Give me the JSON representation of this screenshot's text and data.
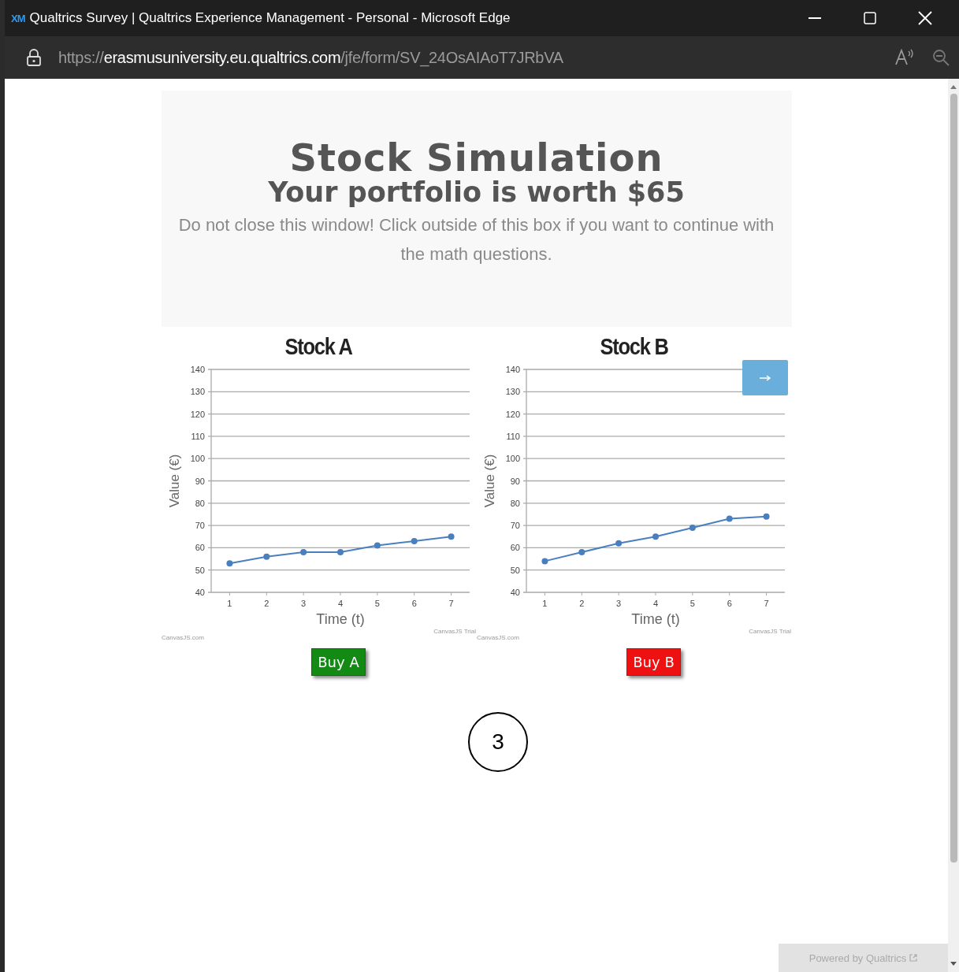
{
  "window": {
    "logo": "XM",
    "title": "Qualtrics Survey | Qualtrics Experience Management - Personal - Microsoft Edge"
  },
  "address_bar": {
    "url": "https://**erasmusuniversity.eu.qualtrics.com**/jfe/form/SV_24OsAIAoT7JRbVA"
  },
  "header": {
    "title": "Stock Simulation",
    "subtitle": "Your portfolio is worth $65",
    "notice": "Do not close this window! Click outside of this box if you want to continue with the math questions."
  },
  "charts": [
    {
      "credit_left": "CanvasJS.com",
      "credit_right": "CanvasJS Trial",
      "buy_button": {
        "label": "Buy A",
        "color": "#138a13"
      },
      "chart_data": {
        "type": "line",
        "title": "Stock A",
        "xlabel": "Time (t)",
        "ylabel": "Value (€)",
        "x": [
          1,
          2,
          3,
          4,
          5,
          6,
          7
        ],
        "series": [
          {
            "color": "#4a7fbf",
            "marker": "circle",
            "values": [
              53,
              56,
              58,
              58,
              61,
              63,
              65
            ]
          }
        ],
        "xlim": [
          0.5,
          7.5
        ],
        "ylim": [
          40,
          140
        ],
        "yticks": [
          40,
          50,
          60,
          70,
          80,
          90,
          100,
          110,
          120,
          130,
          140
        ],
        "xticks": [
          1,
          2,
          3,
          4,
          5,
          6,
          7
        ],
        "grid": true
      }
    },
    {
      "toolbar_button": true,
      "credit_left": "CanvasJS.com",
      "credit_right": "CanvasJS Trial",
      "buy_button": {
        "label": "Buy B",
        "color": "#ee1111"
      },
      "chart_data": {
        "type": "line",
        "title": "Stock B",
        "xlabel": "Time (t)",
        "ylabel": "Value (€)",
        "x": [
          1,
          2,
          3,
          4,
          5,
          6,
          7
        ],
        "series": [
          {
            "color": "#4a7fbf",
            "marker": "circle",
            "values": [
              54,
              58,
              62,
              65,
              69,
              73,
              74
            ]
          }
        ],
        "xlim": [
          0.5,
          7.5
        ],
        "ylim": [
          40,
          140
        ],
        "yticks": [
          40,
          50,
          60,
          70,
          80,
          90,
          100,
          110,
          120,
          130,
          140
        ],
        "xticks": [
          1,
          2,
          3,
          4,
          5,
          6,
          7
        ],
        "grid": true
      }
    }
  ],
  "step_marker": "3",
  "footer": {
    "badge": "Powered by Qualtrics"
  }
}
